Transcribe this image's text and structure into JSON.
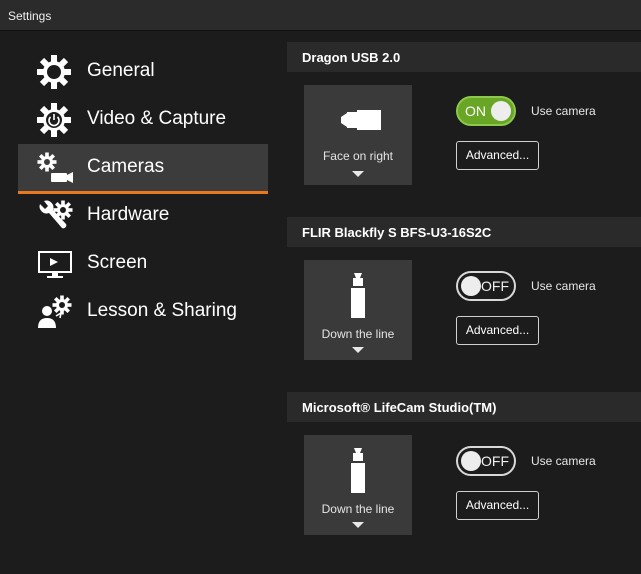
{
  "window": {
    "title": "Settings"
  },
  "sidebar": {
    "items": [
      {
        "label": "General",
        "icon": "gear-icon"
      },
      {
        "label": "Video & Capture",
        "icon": "gear-power-icon"
      },
      {
        "label": "Cameras",
        "icon": "gear-camera-icon",
        "active": true
      },
      {
        "label": "Hardware",
        "icon": "wrench-gear-icon"
      },
      {
        "label": "Screen",
        "icon": "monitor-icon"
      },
      {
        "label": "Lesson & Sharing",
        "icon": "person-gear-icon"
      }
    ]
  },
  "cameras": [
    {
      "name": "Dragon USB 2.0",
      "orientation": "Face on right",
      "orientation_icon": "camera-side-icon",
      "toggle": "ON",
      "enabled": true,
      "use_label": "Use camera",
      "advanced_label": "Advanced..."
    },
    {
      "name": "FLIR Blackfly S BFS-U3-16S2C",
      "orientation": "Down the line",
      "orientation_icon": "camera-down-icon",
      "toggle": "OFF",
      "enabled": false,
      "use_label": "Use camera",
      "advanced_label": "Advanced..."
    },
    {
      "name": "Microsoft® LifeCam Studio(TM)",
      "orientation": "Down the line",
      "orientation_icon": "camera-down-icon",
      "toggle": "OFF",
      "enabled": false,
      "use_label": "Use camera",
      "advanced_label": "Advanced..."
    }
  ],
  "colors": {
    "accent": "#e8771d",
    "toggle_on": "#6aa625",
    "background": "#1c1c1c"
  }
}
